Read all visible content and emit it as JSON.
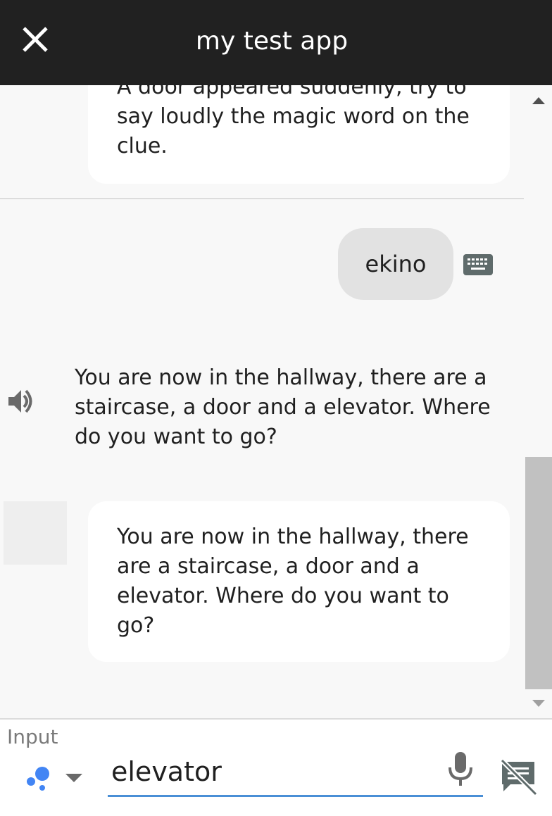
{
  "header": {
    "title": "my test app",
    "close_icon": "close-icon",
    "background": "#212121"
  },
  "conversation": {
    "previous_card_text": "A door appeared suddenly, try to say loudly the magic word on the clue.",
    "user_message": "ekino",
    "user_input_icon": "keyboard-icon",
    "speech_icon": "speaker-icon",
    "speech_text": "You are now in the hallway, there are a staircase, a door and a elevator. Where do you want to go?",
    "display_card_text": "You are now in the hallway, there are a staircase, a door and a elevator. Where do you want to go?"
  },
  "input": {
    "label": "Input",
    "value": "elevator",
    "assistant_icon": "google-assistant-icon",
    "dropdown_icon": "chevron-down-icon",
    "mic_icon": "microphone-icon",
    "display_toggle_icon": "no-display-icon",
    "accent": "#4a8fd6"
  }
}
